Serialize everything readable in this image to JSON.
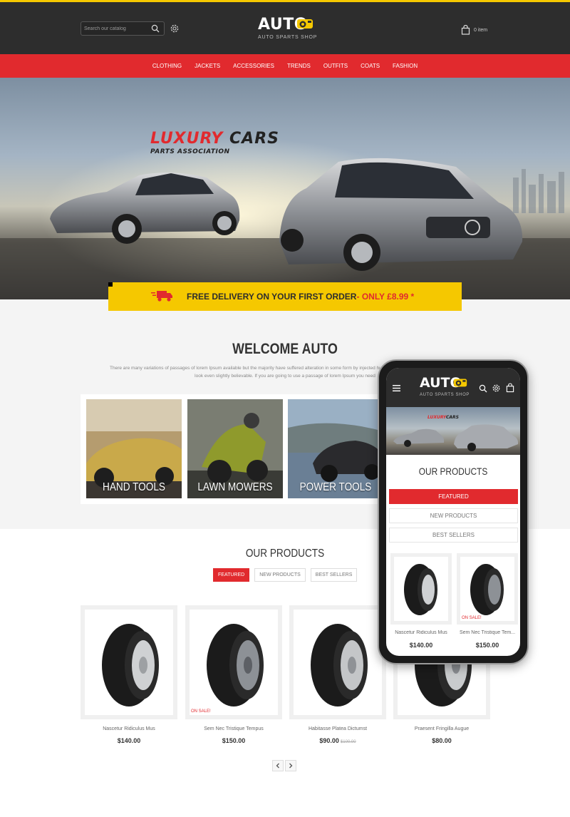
{
  "header": {
    "search_placeholder": "Search our catalog",
    "logo_main": "AUTO",
    "logo_tagline": "AUTO SPARTS SHOP",
    "cart_text": "0 item"
  },
  "nav": {
    "items": [
      "CLOTHING",
      "JACKETS",
      "ACCESSORIES",
      "TRENDS",
      "OUTFITS",
      "COATS",
      "FASHION"
    ]
  },
  "hero": {
    "title_red": "LUXURY",
    "title_dark": "CARS",
    "subtitle": "PARTS ASSOCIATION"
  },
  "delivery": {
    "text": "FREE DELIVERY ON YOUR FIRST ORDER",
    "price_text": "- ONLY £8.99 *"
  },
  "welcome": {
    "title": "WELCOME AUTO",
    "text": "There are many variations of passages of lorem Ipsum available but the majority have suffered alteration in some form by injected humour or randomised words which dont look even slightly believable. If you are going to use a passage of lorem Ipsum you need"
  },
  "categories": [
    {
      "label": "HAND TOOLS"
    },
    {
      "label": "LAWN MOWERS"
    },
    {
      "label": "POWER TOOLS"
    }
  ],
  "products": {
    "title": "OUR PRODUCTS",
    "tabs": [
      "FEATURED",
      "NEW PRODUCTS",
      "BEST SELLERS"
    ],
    "on_sale": "ON SALE!",
    "items": [
      {
        "name": "Nascetur Ridiculus Mus",
        "price": "$140.00",
        "old_price": ""
      },
      {
        "name": "Sem Nec Tristique Tempus",
        "price": "$150.00",
        "old_price": ""
      },
      {
        "name": "Habitasse Platea Dictumst",
        "price": "$90.00",
        "old_price": "$100.00"
      },
      {
        "name": "Praesent Fringilla Augue",
        "price": "$80.00",
        "old_price": ""
      }
    ]
  },
  "mobile": {
    "logo_main": "AUTO",
    "logo_tagline": "AUTO SPARTS SHOP",
    "title": "OUR PRODUCTS",
    "tabs": [
      "FEATURED",
      "NEW PRODUCTS",
      "BEST SELLERS"
    ],
    "items": [
      {
        "name": "Nascetur Ridiculus Mus",
        "price": "$140.00"
      },
      {
        "name": "Sem Nec Tristique Tem...",
        "price": "$150.00"
      }
    ],
    "on_sale": "ON SALE!"
  },
  "colors": {
    "accent_red": "#e12a2e",
    "accent_yellow": "#f5c800",
    "header_dark": "#2d2d2d"
  }
}
